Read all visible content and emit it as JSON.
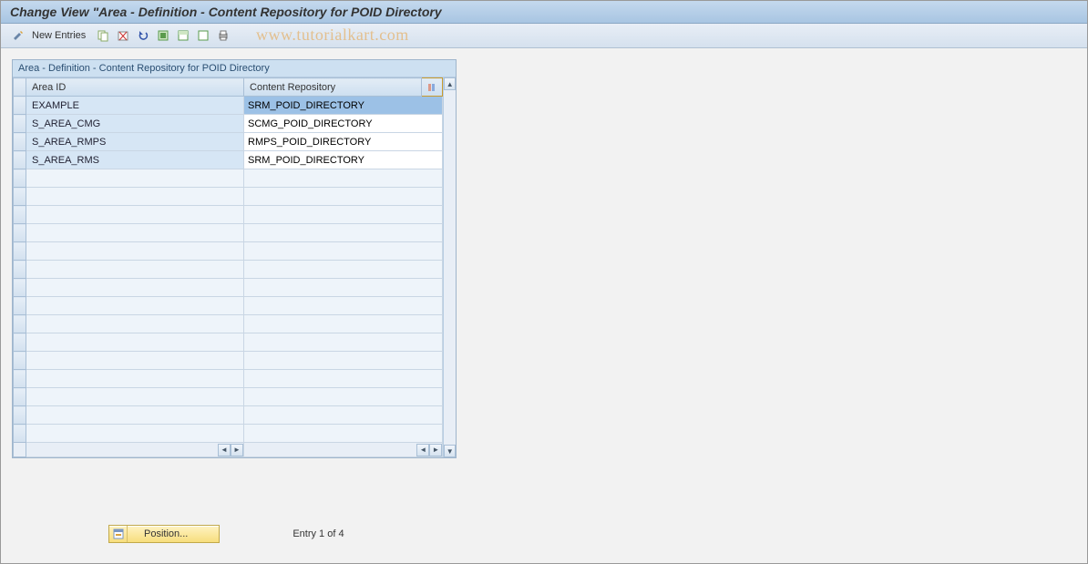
{
  "title": "Change View \"Area - Definition - Content Repository for POID Directory",
  "toolbar": {
    "new_entries": "New Entries"
  },
  "watermark": "www.tutorialkart.com",
  "panel": {
    "title": "Area - Definition - Content Repository for POID Directory",
    "columns": {
      "area_id": "Area ID",
      "content_repo": "Content Repository"
    },
    "rows": [
      {
        "area_id": "EXAMPLE",
        "content_repo": "SRM_POID_DIRECTORY",
        "selected": true
      },
      {
        "area_id": "S_AREA_CMG",
        "content_repo": "SCMG_POID_DIRECTORY",
        "selected": false
      },
      {
        "area_id": "S_AREA_RMPS",
        "content_repo": "RMPS_POID_DIRECTORY",
        "selected": false
      },
      {
        "area_id": "S_AREA_RMS",
        "content_repo": "SRM_POID_DIRECTORY",
        "selected": false
      }
    ],
    "empty_rows": 15
  },
  "footer": {
    "position_btn": "Position...",
    "entry_text": "Entry 1 of 4"
  }
}
